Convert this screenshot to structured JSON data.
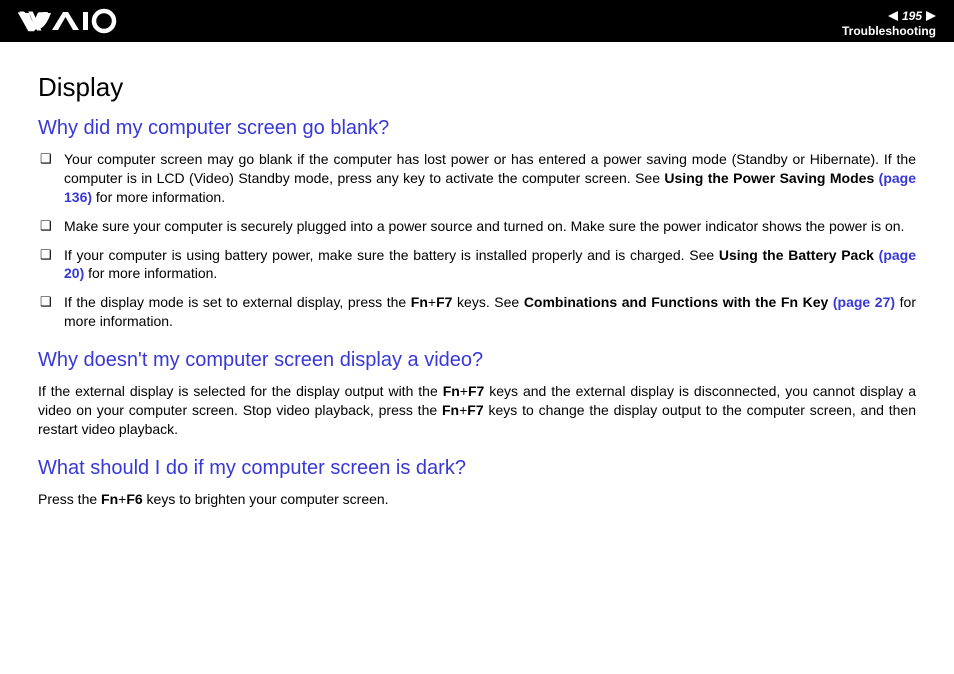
{
  "header": {
    "page_number": "195",
    "section": "Troubleshooting"
  },
  "heading": "Display",
  "q1": {
    "title": "Why did my computer screen go blank?",
    "items": [
      {
        "pre": "Your computer screen may go blank if the computer has lost power or has entered a power saving mode (Standby or Hibernate). If the computer is in LCD (Video) Standby mode, press any key to activate the computer screen. See ",
        "bold": "Using the Power Saving Modes",
        "link": " (page 136)",
        "post": " for more information."
      },
      {
        "pre": "Make sure your computer is securely plugged into a power source and turned on. Make sure the power indicator shows the power is on.",
        "bold": "",
        "link": "",
        "post": ""
      },
      {
        "pre": "If your computer is using battery power, make sure the battery is installed properly and is charged. See ",
        "bold": "Using the Battery Pack",
        "link": " (page 20)",
        "post": " for more information."
      },
      {
        "pre": "If the display mode is set to external display, press the ",
        "key1": "Fn",
        "plus1": "+",
        "key2": "F7",
        "mid": " keys. See ",
        "bold": "Combinations and Functions with the Fn Key",
        "link": " (page 27)",
        "post": " for more information."
      }
    ]
  },
  "q2": {
    "title": "Why doesn't my computer screen display a video?",
    "p_pre": "If the external display is selected for the display output with the ",
    "k1": "Fn",
    "plus1": "+",
    "k2": "F7",
    "p_mid": " keys and the external display is disconnected, you cannot display a video on your computer screen. Stop video playback, press the ",
    "k3": "Fn",
    "plus2": "+",
    "k4": "F7",
    "p_post": " keys to change the display output to the computer screen, and then restart video playback."
  },
  "q3": {
    "title": "What should I do if my computer screen is dark?",
    "p_pre": "Press the ",
    "k1": "Fn",
    "plus1": "+",
    "k2": "F6",
    "p_post": " keys to brighten your computer screen."
  }
}
